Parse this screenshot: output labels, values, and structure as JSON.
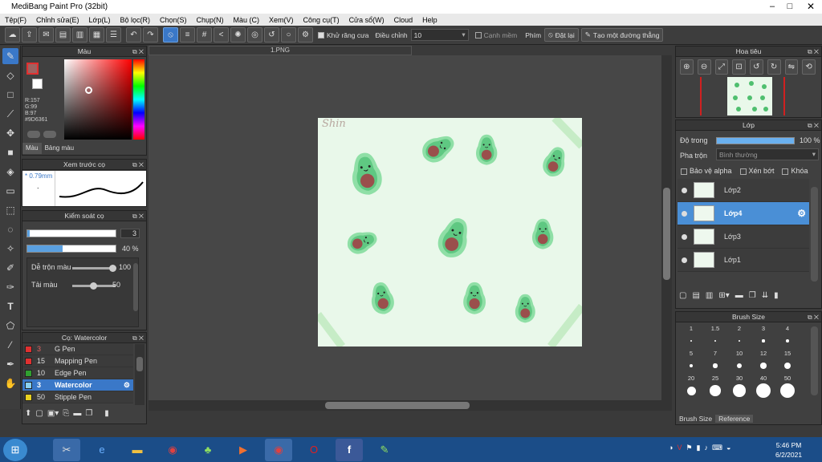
{
  "window": {
    "title": "MediBang Paint Pro (32bit)"
  },
  "menu": [
    "Tệp(F)",
    "Chỉnh sửa(E)",
    "Lớp(L)",
    "Bộ lọc(R)",
    "Chọn(S)",
    "Chụp(N)",
    "Màu (C)",
    "Xem(V)",
    "Công cụ(T)",
    "Cửa sổ(W)",
    "Cloud",
    "Help"
  ],
  "toolbar": {
    "antialias_label": "Khử răng cưa",
    "adjust_label": "Điều chỉnh",
    "adjust_value": "10",
    "edge_label": "Cạnh mềm",
    "snap_label": "Phím",
    "reset_label": "Đặt lại",
    "new_line_label": "Tạo một đường thẳng"
  },
  "color_panel": {
    "title": "Màu",
    "r": "R:157",
    "g": "G:99",
    "b": "B:97",
    "hex": "#9D6361",
    "tab1": "Màu",
    "tab2": "Bảng màu",
    "current_color": "#9D6361"
  },
  "preview_panel": {
    "title": "Xem trước cọ",
    "size": "0.79mm",
    "dot": "."
  },
  "control_panel": {
    "title": "Kiểm soát cọ",
    "size_value": "3",
    "opacity_value": "40 %",
    "opacity_fraction": 0.4,
    "blend_label": "Dễ trộn màu",
    "blend_value": "100",
    "ink_label": "Tải màu",
    "ink_value": "50"
  },
  "brush_panel": {
    "title": "Cọ: Watercolor",
    "items": [
      {
        "size": "3",
        "name": "G Pen",
        "color": "#e03030"
      },
      {
        "size": "15",
        "name": "Mapping Pen",
        "color": "#e03030"
      },
      {
        "size": "10",
        "name": "Edge Pen",
        "color": "#30a030"
      },
      {
        "size": "3",
        "name": "Watercolor",
        "color": "#8ad0f0"
      },
      {
        "size": "50",
        "name": "Stipple Pen",
        "color": "#e8d020"
      }
    ]
  },
  "canvas": {
    "tab": "1.PNG",
    "watermark": "Shin"
  },
  "navigator": {
    "title": "Hoa tiêu"
  },
  "layer_panel": {
    "title": "Lớp",
    "opacity_label": "Độ trong",
    "opacity_value": "100 %",
    "blend_label": "Pha trộn",
    "blend_value": "Bình thường",
    "protect_alpha": "Bảo vệ alpha",
    "clipping": "Xén bớt",
    "lock": "Khóa",
    "layers": [
      "Lớp2",
      "Lớp4",
      "Lớp3",
      "Lớp1"
    ]
  },
  "brush_size_panel": {
    "title": "Brush Size",
    "sizes": [
      "1",
      "1.5",
      "2",
      "3",
      "4",
      "5",
      "7",
      "10",
      "12",
      "15",
      "20",
      "25",
      "30",
      "40",
      "50"
    ],
    "tab1": "Brush Size",
    "tab2": "Reference"
  },
  "taskbar": {
    "time": "5:46 PM",
    "date": "6/2/2021"
  }
}
